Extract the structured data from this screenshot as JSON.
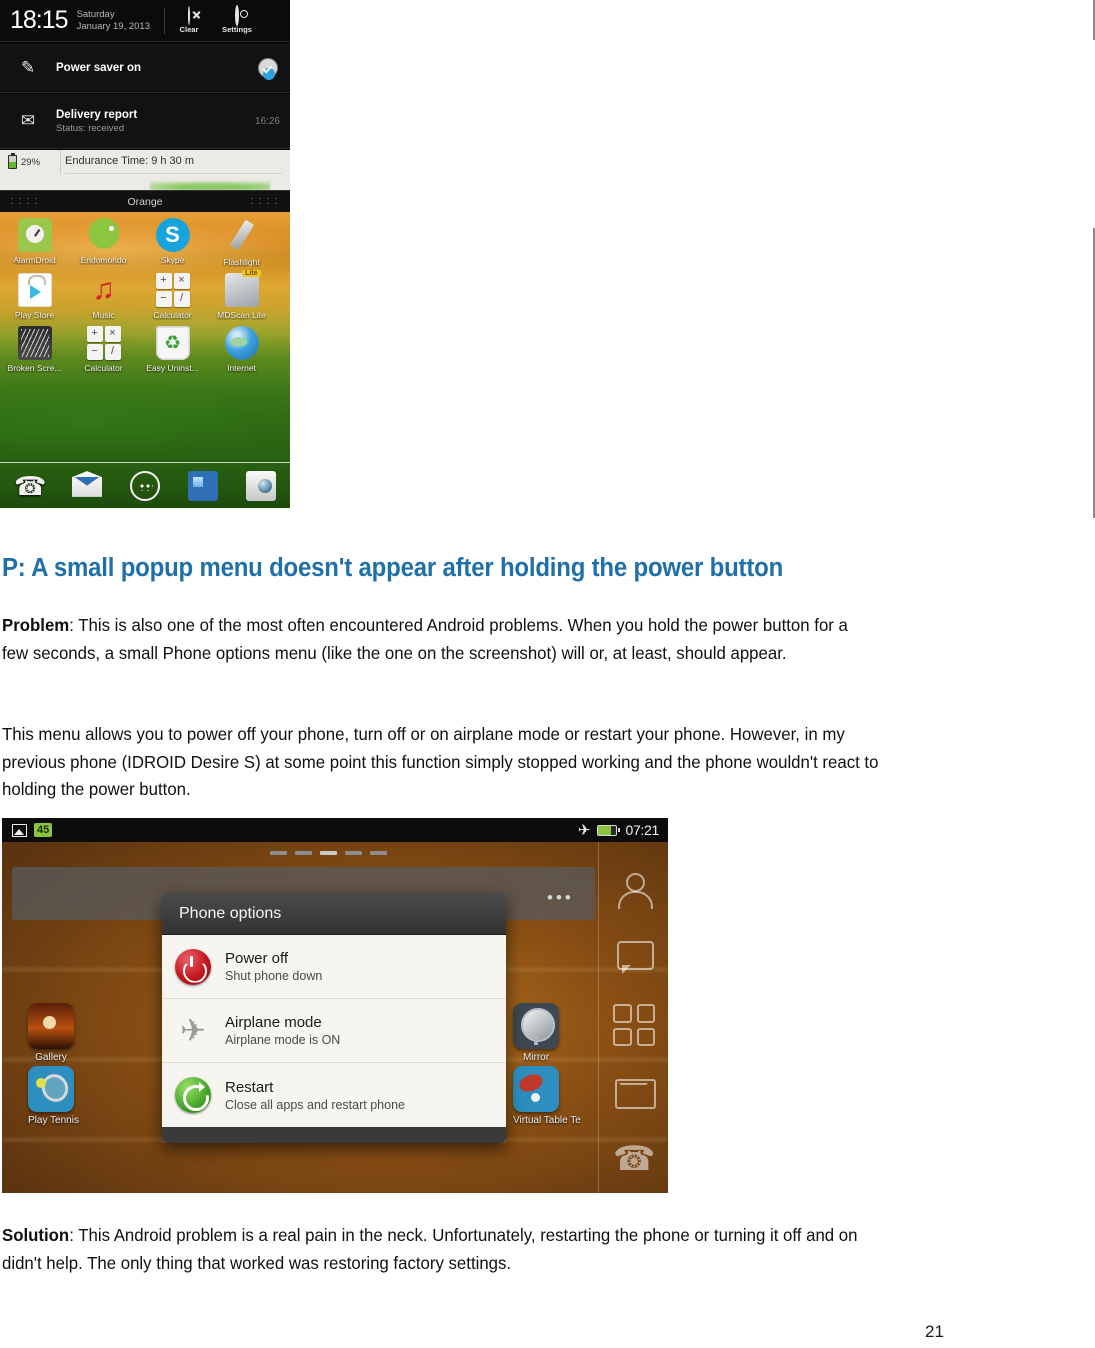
{
  "document": {
    "heading": "P: A small popup menu doesn't appear after holding the power button",
    "problem_label": "Problem",
    "problem_text": ": This is also one of the most often encountered Android problems. When you hold the power button for a few seconds, a small Phone options menu (like the one on the screenshot) will  or, at least, should appear.",
    "menu_paragraph": "This menu allows you to power off your phone, turn off or on airplane mode or restart your phone. However, in my previous phone (IDROID Desire S) at some point this function simply stopped working and the phone wouldn't react to holding the power button.",
    "solution_label": "Solution",
    "solution_text": ": This Android problem is a real pain in the neck. Unfortunately, restarting the phone or turning it off and on didn't help. The only thing that worked was restoring factory settings.",
    "page_number": "21",
    "heading_color": "#1f6fa8"
  },
  "screenshot_notification": {
    "statusbar": {
      "time": "18:15",
      "day": "Saturday",
      "date": "January 19, 2013",
      "clear_label": "Clear",
      "clear_icon": "circle-x-icon",
      "settings_label": "Settings",
      "settings_icon": "gear-icon"
    },
    "notifications": [
      {
        "icon": "power-saver-icon",
        "title": "Power saver on",
        "subtitle": "",
        "time": "",
        "toggle": "checked"
      },
      {
        "icon": "sms-report-icon",
        "title": "Delivery report",
        "subtitle": "Status: received",
        "time": "16:26",
        "toggle": ""
      }
    ],
    "battery_widget": {
      "percent": "29%",
      "endurance": "Endurance Time: 9 h 30 m",
      "battery_icon": "battery-icon"
    },
    "handle": {
      "carrier": "Orange",
      "grip_icon": "grip-dots-icon"
    },
    "home_icons": [
      [
        {
          "label": "AlarmDroid",
          "icon": "alarmdroid-icon"
        },
        {
          "label": "Endomondo",
          "icon": "endomondo-icon"
        },
        {
          "label": "Skype",
          "icon": "skype-icon"
        },
        {
          "label": "Flashlight",
          "icon": "flashlight-icon"
        }
      ],
      [
        {
          "label": "Play Store",
          "icon": "play-store-icon"
        },
        {
          "label": "Music",
          "icon": "music-icon"
        },
        {
          "label": "Calculator",
          "icon": "calculator-icon"
        },
        {
          "label": "MDScan Lite",
          "icon": "mdscan-lite-icon"
        }
      ],
      [
        {
          "label": "Broken Scre...",
          "icon": "broken-screen-icon"
        },
        {
          "label": "Calculator",
          "icon": "calculator-icon"
        },
        {
          "label": "Easy Uninst...",
          "icon": "easy-uninstaller-icon"
        },
        {
          "label": "Internet",
          "icon": "internet-icon"
        }
      ]
    ],
    "calculator_keys": [
      "+",
      "×",
      "−",
      "/"
    ],
    "dock": [
      {
        "icon": "phone-icon"
      },
      {
        "icon": "mail-icon"
      },
      {
        "icon": "app-drawer-icon"
      },
      {
        "icon": "messages-icon"
      },
      {
        "icon": "camera-icon"
      }
    ]
  },
  "screenshot_dialog": {
    "statusbar": {
      "image_icon": "gallery-notification-icon",
      "badge": "45",
      "airplane_icon": "airplane-icon",
      "battery_icon": "battery-icon",
      "time": "07:21"
    },
    "dialog": {
      "title": "Phone options",
      "items": [
        {
          "icon": "power-off-icon",
          "title": "Power off",
          "subtitle": "Shut phone down"
        },
        {
          "icon": "airplane-icon",
          "title": "Airplane mode",
          "subtitle": "Airplane mode is ON"
        },
        {
          "icon": "restart-icon",
          "title": "Restart",
          "subtitle": "Close all apps and restart phone"
        }
      ]
    },
    "home_icons": [
      {
        "label": "Gallery",
        "icon": "gallery-icon"
      },
      {
        "label": "Play Tennis",
        "icon": "play-tennis-icon"
      },
      {
        "label": "Mirror",
        "icon": "mirror-icon"
      },
      {
        "label": "Virtual Table Te",
        "icon": "virtual-table-tennis-icon"
      }
    ],
    "rail_icons": [
      "contact-icon",
      "chat-icon",
      "app-grid-icon",
      "mail-icon",
      "phone-icon"
    ],
    "overflow_icon": "more-dots-icon"
  }
}
